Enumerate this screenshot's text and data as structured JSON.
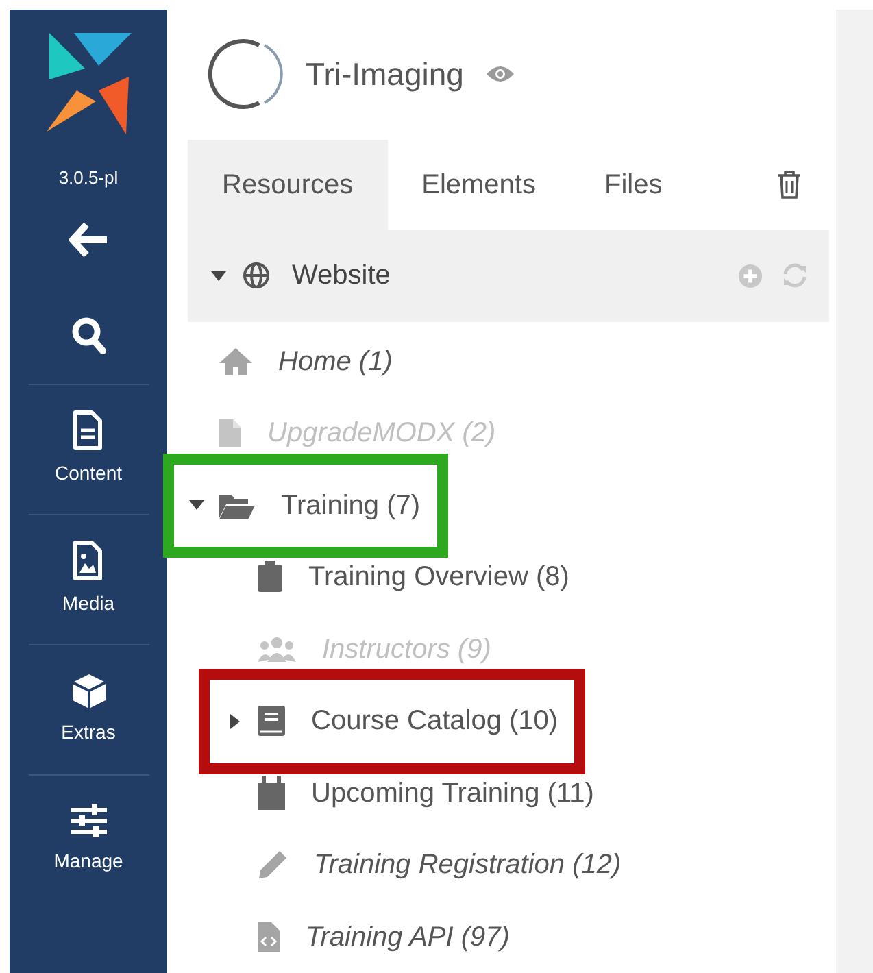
{
  "sidebar": {
    "version": "3.0.5-pl",
    "items": [
      {
        "kind": "back"
      },
      {
        "kind": "search"
      },
      {
        "kind": "content",
        "label": "Content"
      },
      {
        "kind": "media",
        "label": "Media"
      },
      {
        "kind": "extras",
        "label": "Extras"
      },
      {
        "kind": "manage",
        "label": "Manage"
      }
    ]
  },
  "header": {
    "title": "Tri-Imaging"
  },
  "tabs": [
    {
      "label": "Resources",
      "selected": true
    },
    {
      "label": "Elements",
      "selected": false
    },
    {
      "label": "Files",
      "selected": false
    }
  ],
  "tree": {
    "root": {
      "label": "Website",
      "expanded": true
    },
    "items": [
      {
        "label": "Home (1)",
        "kind": "home",
        "italic": true,
        "unpublished": false
      },
      {
        "label": "UpgradeMODX (2)",
        "kind": "page",
        "italic": true,
        "unpublished": true
      },
      {
        "label": "Training (7)",
        "kind": "folder",
        "italic": false,
        "unpublished": false,
        "expanded": true,
        "color": "#2ea81f",
        "children": [
          {
            "label": "Training Overview (8)",
            "kind": "clipboard",
            "italic": false,
            "unpublished": false
          },
          {
            "label": "Instructors (9)",
            "kind": "users",
            "italic": true,
            "unpublished": true
          },
          {
            "label": "Course Catalog (10)",
            "kind": "book",
            "italic": false,
            "unpublished": false,
            "expanded": false,
            "color": "#b50d0d"
          },
          {
            "label": "Upcoming Training (11)",
            "kind": "calendar",
            "italic": false,
            "unpublished": false
          },
          {
            "label": "Training Registration (12)",
            "kind": "pencil",
            "italic": true,
            "unpublished": false
          },
          {
            "label": "Training API (97)",
            "kind": "code",
            "italic": true,
            "unpublished": false
          }
        ]
      }
    ]
  }
}
